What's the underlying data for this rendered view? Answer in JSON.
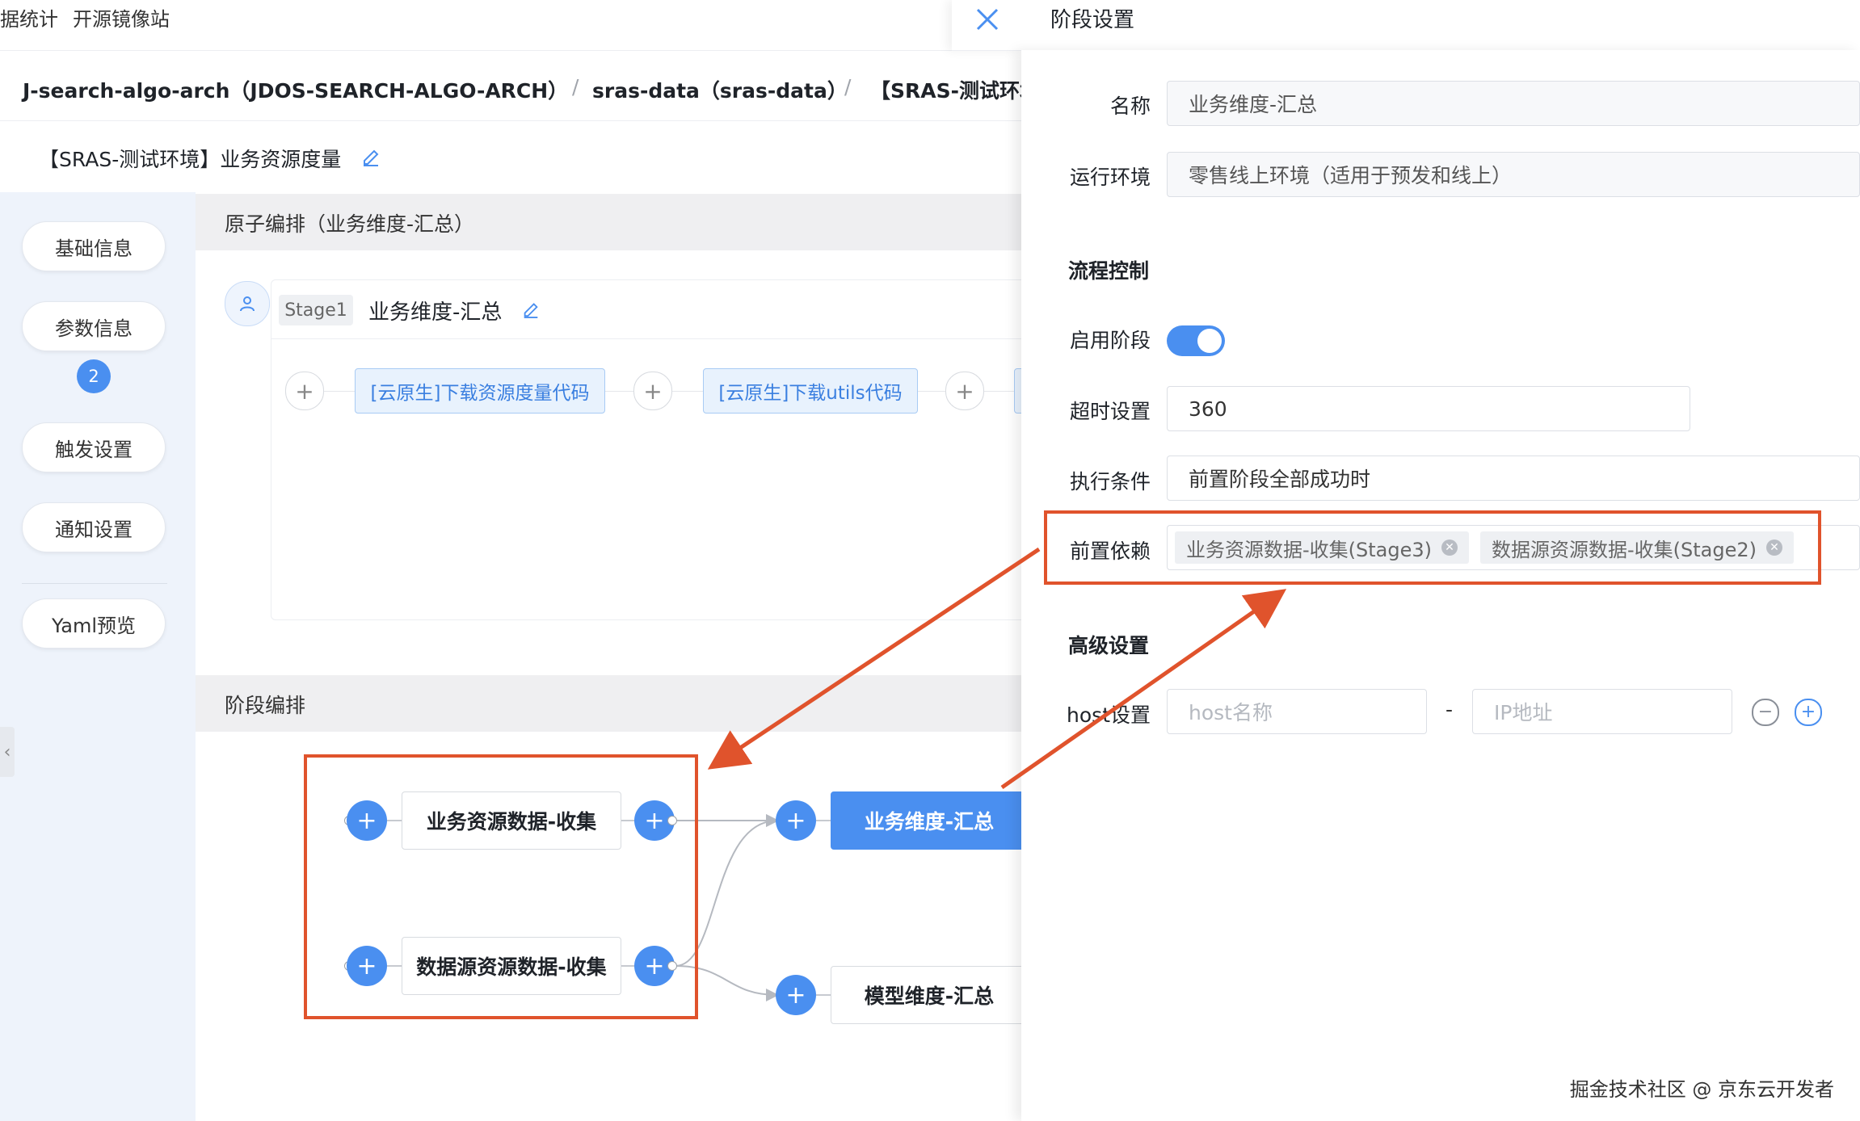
{
  "topnav": {
    "items": [
      "据统计",
      "开源镜像站"
    ]
  },
  "breadcrumb": {
    "app": "J-search-algo-arch（JDOS-SEARCH-ALGO-ARCH）",
    "sep1": "/",
    "system": "sras-data（sras-data）",
    "sep2": "/",
    "pipeline": "【SRAS-测试环境"
  },
  "page": {
    "title": "【SRAS-测试环境】业务资源度量"
  },
  "sidebar": {
    "items": [
      "基础信息",
      "参数信息",
      "触发设置",
      "通知设置",
      "Yaml预览"
    ],
    "badge": "2"
  },
  "atom_section": {
    "title": "原子编排（业务维度-汇总）",
    "stage_tag": "Stage1",
    "stage_name": "业务维度-汇总",
    "jobs": [
      "[云原生]下载资源度量代码",
      "[云原生]下载utils代码"
    ]
  },
  "stage_section": {
    "title": "阶段编排",
    "nodes": [
      "业务资源数据-收集",
      "数据源资源数据-收集",
      "业务维度-汇总",
      "模型维度-汇总"
    ]
  },
  "drawer": {
    "title": "阶段设置",
    "fields": {
      "name_label": "名称",
      "name_value": "业务维度-汇总",
      "env_label": "运行环境",
      "env_value": "零售线上环境（适用于预发和线上）",
      "flow_title": "流程控制",
      "enable_label": "启用阶段",
      "enabled": true,
      "timeout_label": "超时设置",
      "timeout_value": "360",
      "condition_label": "执行条件",
      "condition_value": "前置阶段全部成功时",
      "deps_label": "前置依赖",
      "deps": [
        "业务资源数据-收集(Stage3)",
        "数据源资源数据-收集(Stage2)"
      ],
      "advanced_title": "高级设置",
      "host_label": "host设置",
      "host_placeholder": "host名称",
      "host_dash": "-",
      "ip_placeholder": "IP地址"
    }
  },
  "footer": {
    "watermark": "掘金技术社区 @ 京东云开发者"
  },
  "colors": {
    "accent": "#4a8ff0",
    "highlight": "#e0532c",
    "chip_bg": "#e8f2fd"
  },
  "icons": {
    "close": "close-icon",
    "edit": "edit-icon",
    "plus": "plus-icon",
    "minus": "minus-icon",
    "remove": "remove-tag-icon",
    "user": "user-icon",
    "chevron": "chevron-left-icon"
  }
}
